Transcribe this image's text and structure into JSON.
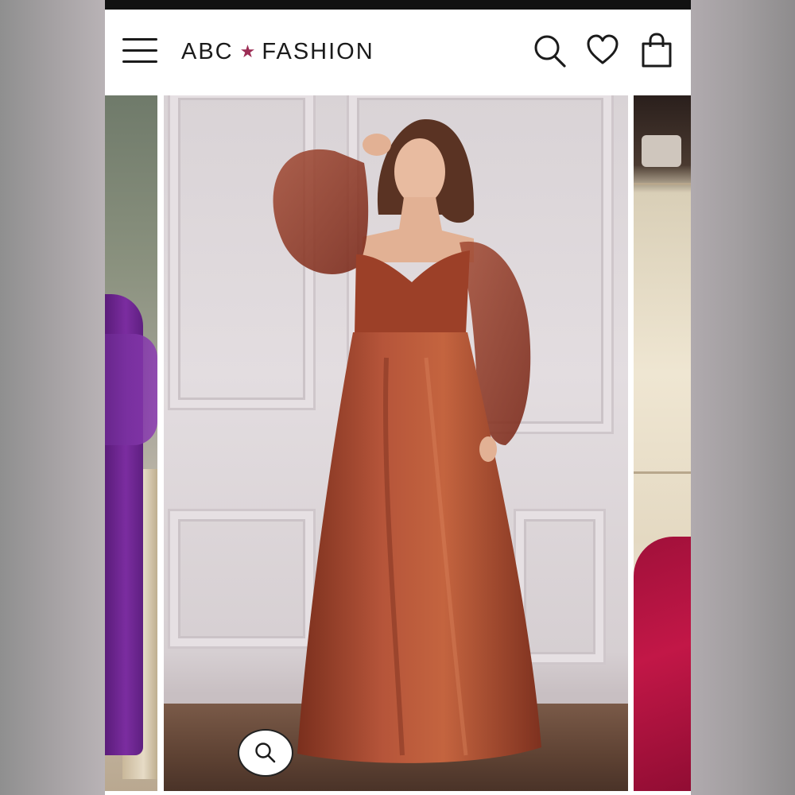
{
  "header": {
    "brand_left": "ABC",
    "brand_star": "★",
    "brand_right": "FASHION",
    "menu_icon": "hamburger-menu-icon",
    "search_icon": "search-icon",
    "wishlist_icon": "heart-icon",
    "bag_icon": "shopping-bag-icon"
  },
  "gallery": {
    "zoom_icon": "zoom-search-icon",
    "slides": [
      {
        "role": "previous",
        "gown_color": "#7b2da0"
      },
      {
        "role": "current",
        "gown_color": "#a3482e"
      },
      {
        "role": "next",
        "gown_color": "#c21747"
      }
    ]
  },
  "colors": {
    "brand_star": "#9c2d55",
    "header_text": "#1b1b1b",
    "status_bar": "#121212"
  }
}
